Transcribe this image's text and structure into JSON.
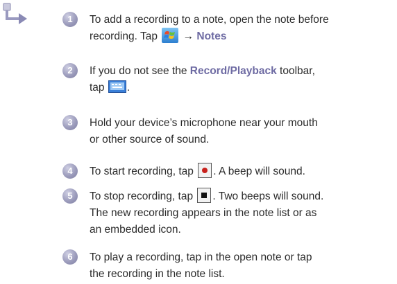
{
  "steps": [
    {
      "number": "1",
      "line1": "To add a recording to a note, open the note before",
      "line2_pre": "recording. Tap",
      "line2_arrow": "→",
      "line2_link": "Notes"
    },
    {
      "number": "2",
      "line1_pre": "If you do not see the",
      "line1_link": "Record/Playback",
      "line1_post": "toolbar,",
      "line2_pre": "tap",
      "line2_post": "."
    },
    {
      "number": "3",
      "line1": "Hold your device’s microphone near your mouth",
      "line2": "or other source of sound."
    },
    {
      "number": "4",
      "line1_pre": "To start recording, tap",
      "line1_post": ".  A beep will sound."
    },
    {
      "number": "5",
      "line1_pre": "To stop recording, tap",
      "line1_post": ". Two beeps will sound.",
      "line2": "The new recording appears in the note list or as",
      "line3": "an embedded icon."
    },
    {
      "number": "6",
      "line1": "To play a recording, tap  in the open note or tap",
      "line2": "the recording in the note list."
    }
  ],
  "icons": {
    "corner": "procedure-arrow-icon",
    "start": "windows-start-icon",
    "toolbar": "keyboard-toolbar-icon",
    "record": "record-button-icon",
    "stop": "stop-button-icon"
  },
  "colors": {
    "link": "#6e6ba3",
    "badge": "#9c9cbc",
    "text": "#2b2b2b",
    "record": "#c8211c"
  }
}
